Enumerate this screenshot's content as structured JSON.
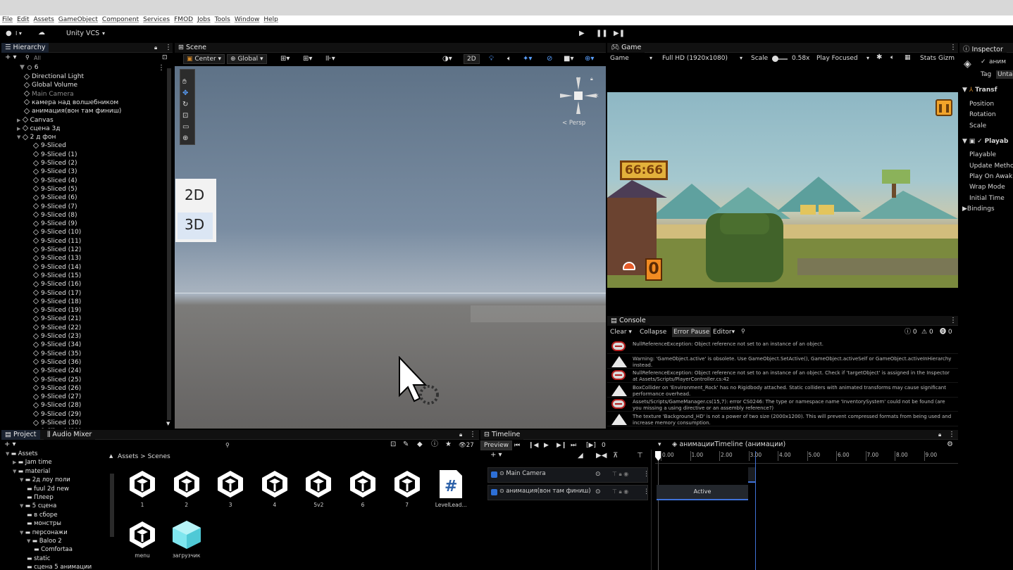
{
  "menu": [
    "File",
    "Edit",
    "Assets",
    "GameObject",
    "Component",
    "Services",
    "FMOD",
    "Jobs",
    "Tools",
    "Window",
    "Help"
  ],
  "toolbar": {
    "vcs": "Unity VCS"
  },
  "hierarchy": {
    "tab": "Hierarchy",
    "search": "All",
    "scene": "6",
    "items": [
      {
        "label": "Directional Light",
        "indent": 2
      },
      {
        "label": "Global Volume",
        "indent": 2
      },
      {
        "label": "Main Camera",
        "indent": 2,
        "dim": true
      },
      {
        "label": "камера над волшебником",
        "indent": 2
      },
      {
        "label": "анимация(вон там финиш)",
        "indent": 2
      },
      {
        "label": "Canvas",
        "indent": 2,
        "arrow": "▶"
      },
      {
        "label": "сцена 3д",
        "indent": 2,
        "arrow": "▶"
      },
      {
        "label": "2 д фон",
        "indent": 2,
        "arrow": "▼"
      },
      {
        "label": "9-Sliced",
        "indent": 3
      },
      {
        "label": "9-Sliced (1)",
        "indent": 3
      },
      {
        "label": "9-Sliced (2)",
        "indent": 3
      },
      {
        "label": "9-Sliced (3)",
        "indent": 3
      },
      {
        "label": "9-Sliced (4)",
        "indent": 3
      },
      {
        "label": "9-Sliced (5)",
        "indent": 3
      },
      {
        "label": "9-Sliced (6)",
        "indent": 3
      },
      {
        "label": "9-Sliced (7)",
        "indent": 3
      },
      {
        "label": "9-Sliced (8)",
        "indent": 3
      },
      {
        "label": "9-Sliced (9)",
        "indent": 3
      },
      {
        "label": "9-Sliced (10)",
        "indent": 3
      },
      {
        "label": "9-Sliced (11)",
        "indent": 3
      },
      {
        "label": "9-Sliced (12)",
        "indent": 3
      },
      {
        "label": "9-Sliced (13)",
        "indent": 3
      },
      {
        "label": "9-Sliced (14)",
        "indent": 3
      },
      {
        "label": "9-Sliced (15)",
        "indent": 3
      },
      {
        "label": "9-Sliced (16)",
        "indent": 3
      },
      {
        "label": "9-Sliced (17)",
        "indent": 3
      },
      {
        "label": "9-Sliced (18)",
        "indent": 3
      },
      {
        "label": "9-Sliced (19)",
        "indent": 3
      },
      {
        "label": "9-Sliced (21)",
        "indent": 3
      },
      {
        "label": "9-Sliced (22)",
        "indent": 3
      },
      {
        "label": "9-Sliced (23)",
        "indent": 3
      },
      {
        "label": "9-Sliced (34)",
        "indent": 3
      },
      {
        "label": "9-Sliced (35)",
        "indent": 3
      },
      {
        "label": "9-Sliced (36)",
        "indent": 3
      },
      {
        "label": "9-Sliced (24)",
        "indent": 3
      },
      {
        "label": "9-Sliced (25)",
        "indent": 3
      },
      {
        "label": "9-Sliced (26)",
        "indent": 3
      },
      {
        "label": "9-Sliced (27)",
        "indent": 3
      },
      {
        "label": "9-Sliced (28)",
        "indent": 3
      },
      {
        "label": "9-Sliced (29)",
        "indent": 3
      },
      {
        "label": "9-Sliced (30)",
        "indent": 3
      },
      {
        "label": "9-Sliced (31)",
        "indent": 3
      }
    ]
  },
  "scene": {
    "tab": "Scene",
    "pivot": "Center",
    "space": "Global",
    "mode2d": "2D",
    "persp": "< Persp",
    "overlay2d": "2D",
    "overlay3d": "3D"
  },
  "game": {
    "tab": "Game",
    "display": "Game",
    "resolution": "Full HD (1920x1080)",
    "scale_label": "Scale",
    "scale_value": "0.58x",
    "play": "Play Focused",
    "stats": "Stats",
    "gizmos": "Gizm",
    "timer": "66:66",
    "counter": "0"
  },
  "console": {
    "tab": "Console",
    "clear": "Clear",
    "collapse": "Collapse",
    "errorpause": "Error Pause",
    "editor": "Editor",
    "counts": [
      "0",
      "0",
      "0"
    ],
    "logs": [
      {
        "type": "error",
        "text": "NullReferenceException: Object reference not set to an instance of an object."
      },
      {
        "type": "warn",
        "text": "Warning: 'GameObject.active' is obsolete. Use GameObject.SetActive(), GameObject.activeSelf or GameObject.activeInHierarchy instead."
      },
      {
        "type": "error",
        "text": "NullReferenceException: Object reference not set to an instance of an object. Check if 'targetObject' is assigned in the Inspector at Assets/Scripts/PlayerController.cs:42"
      },
      {
        "type": "warn",
        "text": "BoxCollider on 'Environment_Rock' has no Rigidbody attached. Static colliders with animated transforms may cause significant performance overhead."
      },
      {
        "type": "error",
        "text": "Assets/Scripts/GameManager.cs(15,7): error CS0246: The type or namespace name 'InventorySystem' could not be found (are you missing a using directive or an assembly reference?)"
      },
      {
        "type": "warn",
        "text": "The texture 'Background_HD' is not a power of two size (2000x1200). This will prevent compressed formats from being used and increase memory consumption."
      }
    ]
  },
  "inspector": {
    "tab": "Inspector",
    "name": "аним",
    "tag_label": "Tag",
    "tag_value": "Untag",
    "transform": "Transf",
    "position": "Position",
    "rotation": "Rotation",
    "scale": "Scale",
    "playable": "Playab",
    "rows": [
      "Playable",
      "Update Metho",
      "Play On Awak",
      "Wrap Mode",
      "Initial Time"
    ],
    "bindings": "Bindings"
  },
  "project": {
    "tab": "Project",
    "tab2": "Audio Mixer",
    "count": "27",
    "breadcrumb": [
      "Assets",
      "Scenes"
    ],
    "tree": [
      {
        "label": "Assets",
        "depth": 0,
        "arrow": "▼"
      },
      {
        "label": "Jam time",
        "depth": 1,
        "arrow": "▶"
      },
      {
        "label": "material",
        "depth": 1,
        "arrow": "▼"
      },
      {
        "label": "2д лоу поли",
        "depth": 2,
        "arrow": "▼"
      },
      {
        "label": "fuul 2d new",
        "depth": 3
      },
      {
        "label": "Плеер",
        "depth": 3
      },
      {
        "label": "5 сцена",
        "depth": 2,
        "arrow": "▼"
      },
      {
        "label": "в сборе",
        "depth": 3
      },
      {
        "label": "монстры",
        "depth": 3
      },
      {
        "label": "персонажи",
        "depth": 2,
        "arrow": "▼"
      },
      {
        "label": "Baloo 2",
        "depth": 3,
        "arrow": "▼"
      },
      {
        "label": "Comfortaa",
        "depth": 4
      },
      {
        "label": "static",
        "depth": 3
      },
      {
        "label": "сцена 5 анимации",
        "depth": 3
      }
    ],
    "assets": [
      {
        "label": "1",
        "kind": "unity"
      },
      {
        "label": "2",
        "kind": "unity"
      },
      {
        "label": "3",
        "kind": "unity"
      },
      {
        "label": "4",
        "kind": "unity"
      },
      {
        "label": "5v2",
        "kind": "unity"
      },
      {
        "label": "6",
        "kind": "unity"
      },
      {
        "label": "7",
        "kind": "unity"
      },
      {
        "label": "LevelLead...",
        "kind": "script"
      },
      {
        "label": "menu",
        "kind": "unity"
      },
      {
        "label": "загрузчик",
        "kind": "prefab"
      }
    ]
  },
  "timeline": {
    "tab": "Timeline",
    "preview": "Preview",
    "frame": "0",
    "asset": "анимацииTimeline (анимации)",
    "tracks": [
      "Main Camera",
      "анимация(вон там финиш)"
    ],
    "clip": "Active",
    "ticks": [
      "0.00",
      "1.00",
      "2.00",
      "3.00",
      "4.00",
      "5.00",
      "6.00",
      "7.00",
      "8.00",
      "9.00"
    ]
  }
}
